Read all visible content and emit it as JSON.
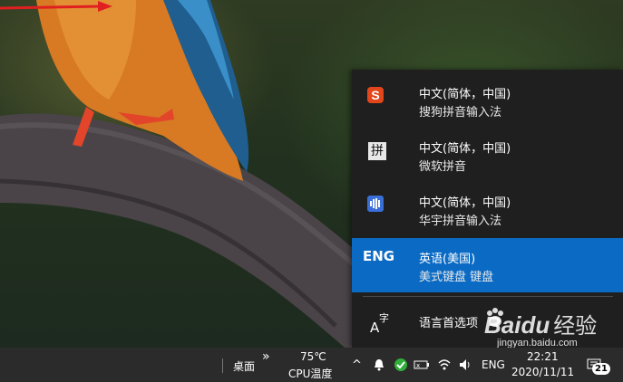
{
  "language_menu": {
    "items": [
      {
        "line1": "中文(简体，中国)",
        "line2": "搜狗拼音输入法",
        "icon": "sogou-s-icon",
        "icon_color": "#e2461b"
      },
      {
        "line1": "中文(简体，中国)",
        "line2": "微软拼音",
        "icon": "microsoft-pinyin-icon",
        "icon_glyph": "拼"
      },
      {
        "line1": "中文(简体，中国)",
        "line2": "华宇拼音输入法",
        "icon": "huayu-pinyin-icon",
        "icon_color": "#3a6fd8"
      },
      {
        "code": "ENG",
        "line1": "英语(美国)",
        "line2": "美式键盘 键盘",
        "selected": true
      }
    ],
    "preferences_label": "语言首选项",
    "preferences_icon_glyph": "字"
  },
  "taskbar": {
    "desktop_label": "桌面",
    "overflow_glyph": "»",
    "cpu_temp": "75℃",
    "cpu_label": "CPU温度",
    "chevron_glyph": "^",
    "input_indicator": "ENG",
    "time": "22:21",
    "date": "2020/11/11",
    "notification_count": "21"
  },
  "watermark": {
    "brand": "Bai",
    "brand_tail": "du",
    "suffix": "经验",
    "url": "jingyan.baidu.com"
  },
  "colors": {
    "selected_bg": "#0b6bc4",
    "flyout_bg": "#1f1f1f",
    "taskbar_bg": "#2b2b2b",
    "arrow": "#e02020"
  }
}
